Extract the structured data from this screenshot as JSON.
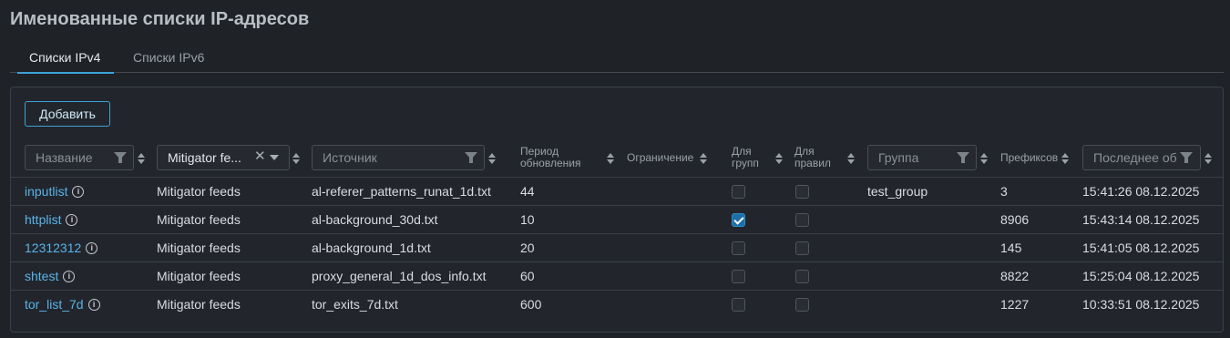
{
  "page": {
    "title": "Именованные списки IP-адресов"
  },
  "tabs": [
    {
      "label": "Списки IPv4",
      "active": true
    },
    {
      "label": "Списки IPv6",
      "active": false
    }
  ],
  "toolbar": {
    "add_label": "Добавить"
  },
  "columns": {
    "name": {
      "placeholder": "Название"
    },
    "feed": {
      "value": "Mitigator fe..."
    },
    "source": {
      "placeholder": "Источник"
    },
    "period": {
      "line1": "Период",
      "line2": "обновления"
    },
    "limit": {
      "label": "Ограничение"
    },
    "for_groups": {
      "line1": "Для",
      "line2": "групп"
    },
    "for_rules": {
      "line1": "Для",
      "line2": "правил"
    },
    "group": {
      "placeholder": "Группа"
    },
    "prefixes": {
      "label": "Префиксов"
    },
    "last_update": {
      "placeholder": "Последнее об"
    }
  },
  "rows": [
    {
      "name": "inputlist",
      "feed": "Mitigator feeds",
      "source": "al-referer_patterns_runat_1d.txt",
      "period": "44",
      "limit": "",
      "for_groups": false,
      "for_rules": false,
      "group": "test_group",
      "prefixes": "3",
      "updated": "15:41:26 08.12.2025"
    },
    {
      "name": "httplist",
      "feed": "Mitigator feeds",
      "source": "al-background_30d.txt",
      "period": "10",
      "limit": "",
      "for_groups": true,
      "for_rules": false,
      "group": "",
      "prefixes": "8906",
      "updated": "15:43:14 08.12.2025"
    },
    {
      "name": "12312312",
      "feed": "Mitigator feeds",
      "source": "al-background_1d.txt",
      "period": "20",
      "limit": "",
      "for_groups": false,
      "for_rules": false,
      "group": "",
      "prefixes": "145",
      "updated": "15:41:05 08.12.2025"
    },
    {
      "name": "shtest",
      "feed": "Mitigator feeds",
      "source": "proxy_general_1d_dos_info.txt",
      "period": "60",
      "limit": "",
      "for_groups": false,
      "for_rules": false,
      "group": "",
      "prefixes": "8822",
      "updated": "15:25:04 08.12.2025"
    },
    {
      "name": "tor_list_7d",
      "feed": "Mitigator feeds",
      "source": "tor_exits_7d.txt",
      "period": "600",
      "limit": "",
      "for_groups": false,
      "for_rules": false,
      "group": "",
      "prefixes": "1227",
      "updated": "10:33:51 08.12.2025"
    }
  ],
  "colors": {
    "accent": "#3ea0d6",
    "link": "#59b3ea",
    "background": "#1f2227",
    "panel": "#22262c"
  }
}
